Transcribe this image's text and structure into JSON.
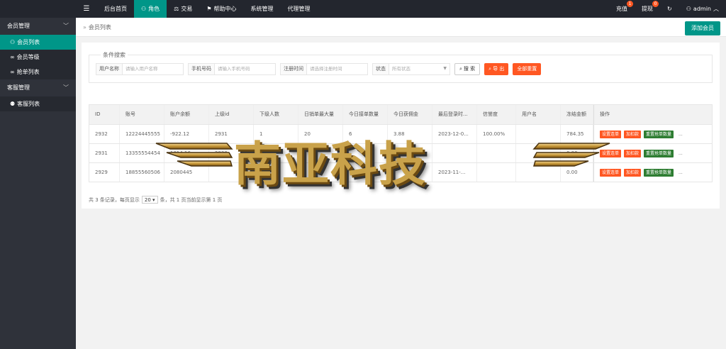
{
  "topbar": {
    "menu_icon": "menu-icon",
    "nav": [
      {
        "label": "后台首页",
        "active": false,
        "icon": ""
      },
      {
        "label": "角色",
        "active": true,
        "icon": "user-icon"
      },
      {
        "label": "交易",
        "active": false,
        "icon": "scale-icon"
      },
      {
        "label": "帮助中心",
        "active": false,
        "icon": "flag-icon"
      },
      {
        "label": "系统管理",
        "active": false,
        "icon": ""
      },
      {
        "label": "代理管理",
        "active": false,
        "icon": ""
      }
    ],
    "right": {
      "recharge": {
        "label": "充值",
        "badge": "1"
      },
      "withdraw": {
        "label": "提现",
        "badge": "0"
      },
      "user": "admin"
    }
  },
  "sidebar": {
    "groups": [
      {
        "label": "会员管理",
        "items": [
          {
            "label": "会员列表",
            "active": true,
            "icon": "user-icon"
          },
          {
            "label": "会员等级",
            "active": false,
            "icon": "link-icon"
          },
          {
            "label": "抢单列表",
            "active": false,
            "icon": "link-icon"
          }
        ]
      },
      {
        "label": "客服管理",
        "items": [
          {
            "label": "客服列表",
            "active": false,
            "icon": "users-icon"
          }
        ]
      }
    ]
  },
  "breadcrumb": "会员列表",
  "add_button": "添加会员",
  "search": {
    "legend": "条件搜索",
    "fields": [
      {
        "label": "用户名称",
        "placeholder": "请输入用户名称"
      },
      {
        "label": "手机号码",
        "placeholder": "请输入手机号码"
      },
      {
        "label": "注册时间",
        "placeholder": "请选择注册时间"
      },
      {
        "label": "状态",
        "placeholder": "所有状态"
      }
    ],
    "search_btn": "搜 索",
    "export_btn": "导 出",
    "reset_btn": "全部重置"
  },
  "table": {
    "headers": [
      "ID",
      "账号",
      "账户余额",
      "上级id",
      "下级人数",
      "日销单最大量",
      "今日接单数量",
      "今日获佣金",
      "最后登录时...",
      "信誉度",
      "用户名",
      "冻结金额",
      "操作"
    ],
    "rows": [
      {
        "cells": [
          "2932",
          "12224445555",
          "-922.12",
          "2931",
          "1",
          "20",
          "6",
          "3.88",
          "2023-12-0...",
          "100.00%",
          "",
          "784.35"
        ]
      },
      {
        "cells": [
          "2931",
          "13355554454",
          "1014.16",
          "2930",
          "",
          "",
          "",
          "",
          "",
          "",
          "",
          "0.00"
        ]
      },
      {
        "cells": [
          "2929",
          "18855560506",
          "2080445",
          "",
          "",
          "",
          "",
          "",
          "2023-11-...",
          "",
          "",
          "0.00"
        ]
      }
    ],
    "ops": [
      "设置连单",
      "加扣款",
      "重置抢单数量",
      "..."
    ]
  },
  "pager": {
    "prefix": "共 3 条记录，每页显示",
    "page_size": "20",
    "suffix": "条，共 1 页当前显示第 1 页"
  },
  "watermark": "南亚科技"
}
